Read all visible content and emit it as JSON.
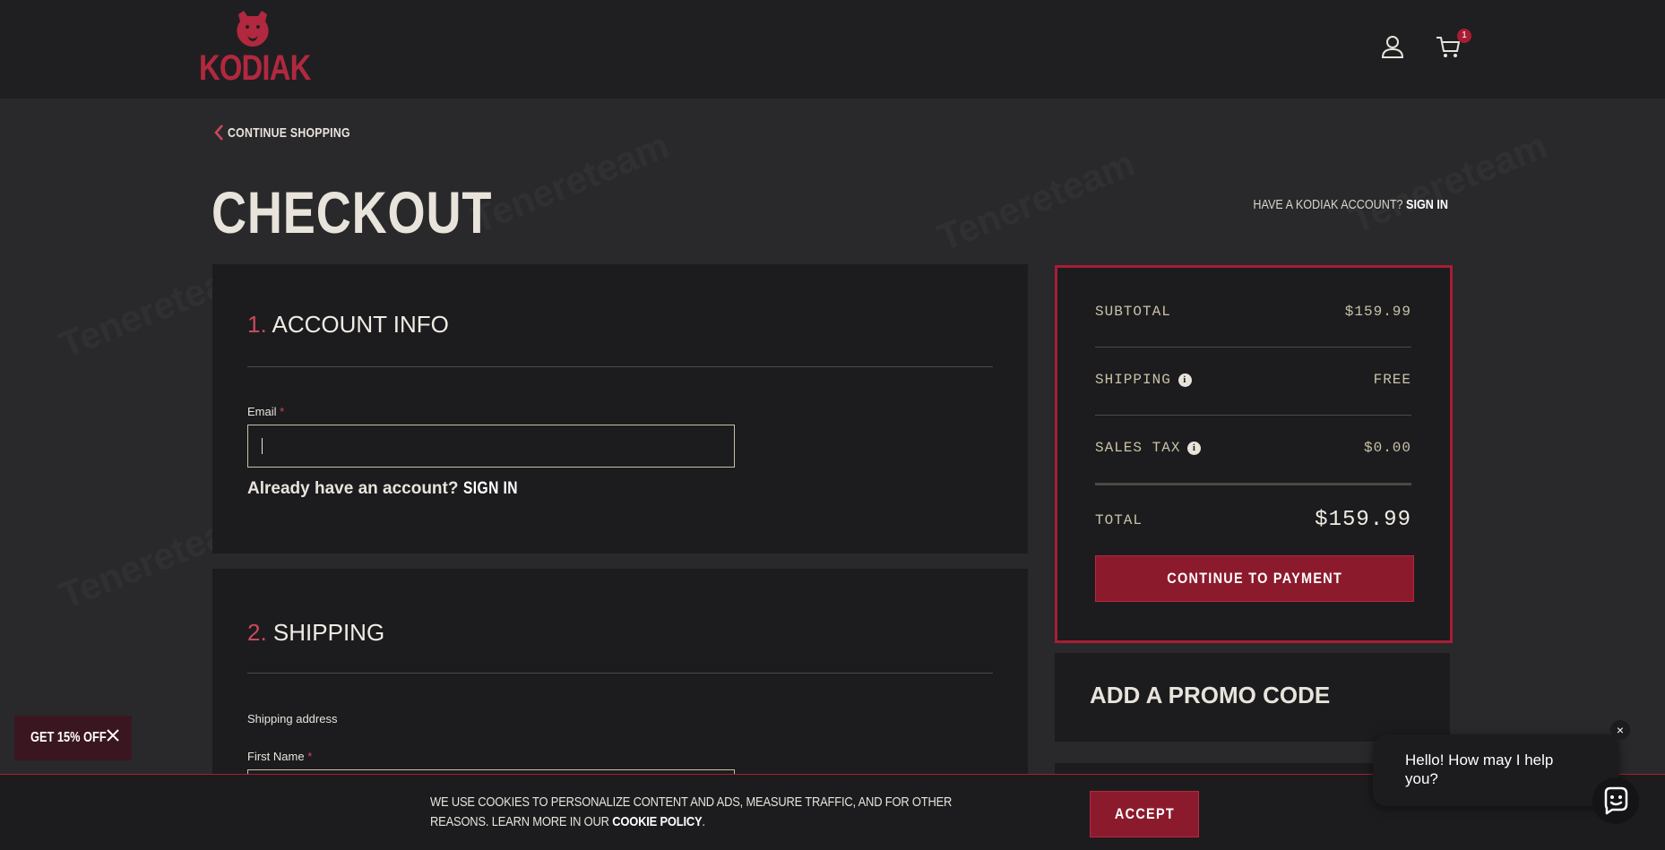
{
  "header": {
    "logo_text": "KODIAK",
    "cart_count": "1",
    "icons": {
      "account": "user-icon",
      "cart": "cart-icon"
    }
  },
  "nav": {
    "continue_shopping": "CONTINUE SHOPPING"
  },
  "page": {
    "title": "CHECKOUT",
    "have_account_prefix": "HAVE A KODIAK ACCOUNT?",
    "have_account_link": "SIGN IN"
  },
  "account_info": {
    "step_number": "1.",
    "step_title": "ACCOUNT INFO",
    "email_label": "Email",
    "required_mark": "*",
    "email_value": "",
    "already_text": "Already have an account?",
    "sign_in_link": "SIGN IN"
  },
  "shipping": {
    "step_number": "2.",
    "step_title": "SHIPPING",
    "address_label": "Shipping address",
    "first_name_label": "First Name",
    "required_mark": "*"
  },
  "summary": {
    "subtotal_label": "SUBTOTAL",
    "subtotal_value": "$159.99",
    "shipping_label": "SHIPPING",
    "shipping_value": "FREE",
    "tax_label": "SALES TAX",
    "tax_value": "$0.00",
    "total_label": "TOTAL",
    "total_value": "$159.99",
    "pay_button": "CONTINUE TO PAYMENT",
    "info_glyph": "i"
  },
  "promo": {
    "title": "ADD A PROMO CODE"
  },
  "discount": {
    "label": "GET 15% OFF"
  },
  "cookie": {
    "text": "WE USE COOKIES TO PERSONALIZE CONTENT AND ADS, MEASURE TRAFFIC, AND FOR OTHER REASONS. LEARN MORE IN OUR",
    "link": "COOKIE POLICY",
    "period": ".",
    "accept": "ACCEPT"
  },
  "chat": {
    "greeting": "Hello! How may I help you?",
    "close": "×"
  },
  "colors": {
    "accent": "#a81d33",
    "button": "#8c1a2d",
    "background": "#29292b",
    "panel": "#1c1c1e",
    "header": "#1f1f21"
  }
}
